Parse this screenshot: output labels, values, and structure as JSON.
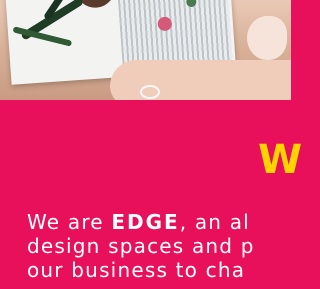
{
  "accent": {
    "heading_partial": "W"
  },
  "intro": {
    "line1_before": "We are ",
    "brand": "EDGE",
    "line1_after": ", an al",
    "line2": "design spaces and p",
    "line3": "our business to cha"
  },
  "colors": {
    "background": "#e8105a",
    "accent_yellow": "#ffd400",
    "text": "#ffffff"
  }
}
